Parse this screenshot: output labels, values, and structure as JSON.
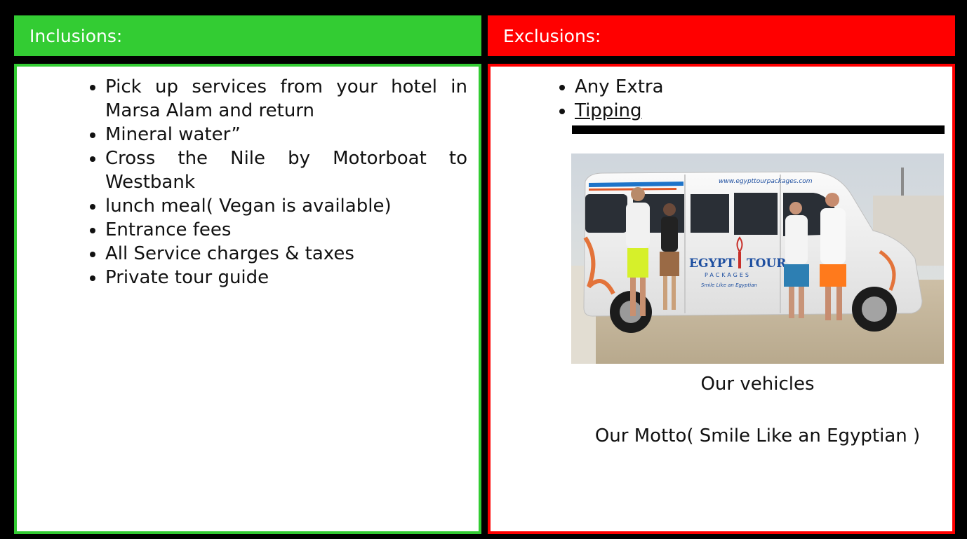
{
  "inclusions": {
    "title": "Inclusions:",
    "items": [
      "Pick up services from your hotel in Marsa Alam and return",
      "Mineral water”",
      "Cross the Nile by Motorboat to Westbank",
      "lunch meal( Vegan is available)",
      "Entrance fees",
      "All Service charges & taxes",
      "Private tour guide"
    ]
  },
  "exclusions": {
    "title": "Exclusions:",
    "items": [
      "Any Extra",
      "Tipping"
    ],
    "image_caption": "Our vehicles",
    "motto": "Our Motto( Smile Like an Egyptian )",
    "van_text": {
      "website": "www.egypttourpackages.com",
      "logo_word_left": "EGYPT",
      "logo_word_right": "TOUR",
      "logo_sub": "PACKAGES",
      "logo_slogan": "Smile Like an Egyptian"
    }
  },
  "colors": {
    "inclusions_accent": "#33cc33",
    "exclusions_accent": "#ff0000",
    "frame": "#000000"
  }
}
